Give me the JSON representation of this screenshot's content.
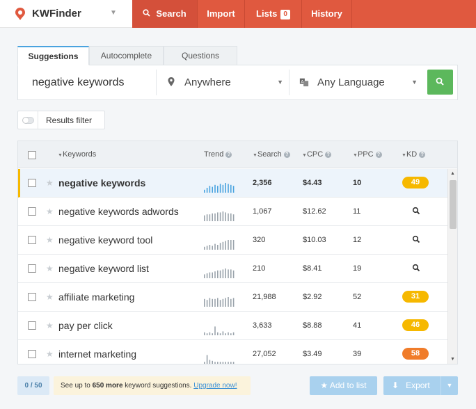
{
  "header": {
    "brand": "KWFinder",
    "nav": {
      "search": "Search",
      "import": "Import",
      "lists": "Lists",
      "lists_count": "0",
      "history": "History"
    }
  },
  "tabs": [
    "Suggestions",
    "Autocomplete",
    "Questions"
  ],
  "search": {
    "keyword": "negative keywords",
    "location": "Anywhere",
    "language": "Any Language"
  },
  "filter": {
    "label": "Results filter"
  },
  "table": {
    "headers": {
      "keywords": "Keywords",
      "trend": "Trend",
      "search": "Search",
      "cpc": "CPC",
      "ppc": "PPC",
      "kd": "KD"
    },
    "rows": [
      {
        "keyword": "negative keywords",
        "search": "2,356",
        "cpc": "$4.43",
        "ppc": "10",
        "kd": "49",
        "kd_color": "#f6b800",
        "trend": [
          3,
          5,
          7,
          6,
          8,
          7,
          9,
          8,
          10,
          9,
          8,
          7
        ],
        "trend_color": "#4aa3df"
      },
      {
        "keyword": "negative keywords adwords",
        "search": "1,067",
        "cpc": "$12.62",
        "ppc": "11",
        "kd": "",
        "kd_color": "",
        "trend": [
          6,
          7,
          7,
          8,
          8,
          9,
          9,
          10,
          9,
          8,
          8,
          7
        ],
        "trend_color": "#9aa3ab"
      },
      {
        "keyword": "negative keyword tool",
        "search": "320",
        "cpc": "$10.03",
        "ppc": "12",
        "kd": "",
        "kd_color": "",
        "trend": [
          3,
          4,
          5,
          4,
          6,
          5,
          7,
          8,
          9,
          10,
          10,
          10
        ],
        "trend_color": "#9aa3ab"
      },
      {
        "keyword": "negative keyword list",
        "search": "210",
        "cpc": "$8.41",
        "ppc": "19",
        "kd": "",
        "kd_color": "",
        "trend": [
          4,
          5,
          6,
          6,
          7,
          8,
          8,
          9,
          10,
          9,
          9,
          8
        ],
        "trend_color": "#9aa3ab"
      },
      {
        "keyword": "affiliate marketing",
        "search": "21,988",
        "cpc": "$2.92",
        "ppc": "52",
        "kd": "31",
        "kd_color": "#f6b800",
        "trend": [
          8,
          7,
          9,
          8,
          8,
          9,
          7,
          8,
          9,
          10,
          8,
          9
        ],
        "trend_color": "#9aa3ab"
      },
      {
        "keyword": "pay per click",
        "search": "3,633",
        "cpc": "$8.88",
        "ppc": "41",
        "kd": "46",
        "kd_color": "#f6b800",
        "trend": [
          3,
          2,
          3,
          2,
          9,
          3,
          2,
          4,
          2,
          3,
          2,
          3
        ],
        "trend_color": "#9aa3ab"
      },
      {
        "keyword": "internet marketing",
        "search": "27,052",
        "cpc": "$3.49",
        "ppc": "39",
        "kd": "58",
        "kd_color": "#f07c2a",
        "trend": [
          2,
          9,
          4,
          3,
          2,
          2,
          2,
          2,
          2,
          2,
          2,
          2
        ],
        "trend_color": "#9aa3ab"
      }
    ]
  },
  "footer": {
    "counter": "0 / 50",
    "upsell_prefix": "See up to ",
    "upsell_bold": "650 more",
    "upsell_suffix": " keyword suggestions. ",
    "upsell_link": "Upgrade now!",
    "add_to_list": "Add to list",
    "export": "Export"
  }
}
